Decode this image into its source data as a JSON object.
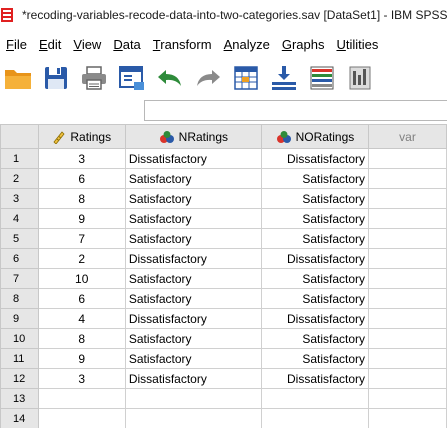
{
  "window": {
    "title": "*recoding-variables-recode-data-into-two-categories.sav [DataSet1] - IBM SPSS"
  },
  "menu": [
    {
      "label": "File",
      "key": "F",
      "rest": "ile"
    },
    {
      "label": "Edit",
      "key": "E",
      "rest": "dit"
    },
    {
      "label": "View",
      "key": "V",
      "rest": "iew"
    },
    {
      "label": "Data",
      "key": "D",
      "rest": "ata"
    },
    {
      "label": "Transform",
      "key": "T",
      "rest": "ransform"
    },
    {
      "label": "Analyze",
      "key": "A",
      "rest": "nalyze"
    },
    {
      "label": "Graphs",
      "key": "G",
      "rest": "raphs"
    },
    {
      "label": "Utilities",
      "key": "U",
      "rest": "tilities"
    }
  ],
  "toolbar": {
    "icons": [
      "open-folder-icon",
      "save-icon",
      "print-icon",
      "dialog-recall-icon",
      "undo-icon",
      "redo-icon",
      "goto-case-icon",
      "goto-variable-icon",
      "variables-icon",
      "run-descriptives-icon"
    ],
    "colors": {
      "folder": "#f0a020",
      "save": "#2a5aa8",
      "green": "#2e8b3a",
      "grey": "#8a8a8a"
    }
  },
  "grid": {
    "columns": {
      "c1": "Ratings",
      "c2": "NRatings",
      "c3": "NORatings",
      "c4": "var"
    },
    "rows": [
      {
        "n": "1",
        "r": "3",
        "nr": "Dissatisfactory",
        "nor": "Dissatisfactory"
      },
      {
        "n": "2",
        "r": "6",
        "nr": "Satisfactory",
        "nor": "Satisfactory"
      },
      {
        "n": "3",
        "r": "8",
        "nr": "Satisfactory",
        "nor": "Satisfactory"
      },
      {
        "n": "4",
        "r": "9",
        "nr": "Satisfactory",
        "nor": "Satisfactory"
      },
      {
        "n": "5",
        "r": "7",
        "nr": "Satisfactory",
        "nor": "Satisfactory"
      },
      {
        "n": "6",
        "r": "2",
        "nr": "Dissatisfactory",
        "nor": "Dissatisfactory"
      },
      {
        "n": "7",
        "r": "10",
        "nr": "Satisfactory",
        "nor": "Satisfactory"
      },
      {
        "n": "8",
        "r": "6",
        "nr": "Satisfactory",
        "nor": "Satisfactory"
      },
      {
        "n": "9",
        "r": "4",
        "nr": "Dissatisfactory",
        "nor": "Dissatisfactory"
      },
      {
        "n": "10",
        "r": "8",
        "nr": "Satisfactory",
        "nor": "Satisfactory"
      },
      {
        "n": "11",
        "r": "9",
        "nr": "Satisfactory",
        "nor": "Satisfactory"
      },
      {
        "n": "12",
        "r": "3",
        "nr": "Dissatisfactory",
        "nor": "Dissatisfactory"
      },
      {
        "n": "13",
        "r": "",
        "nr": "",
        "nor": ""
      },
      {
        "n": "14",
        "r": "",
        "nr": "",
        "nor": ""
      }
    ]
  }
}
